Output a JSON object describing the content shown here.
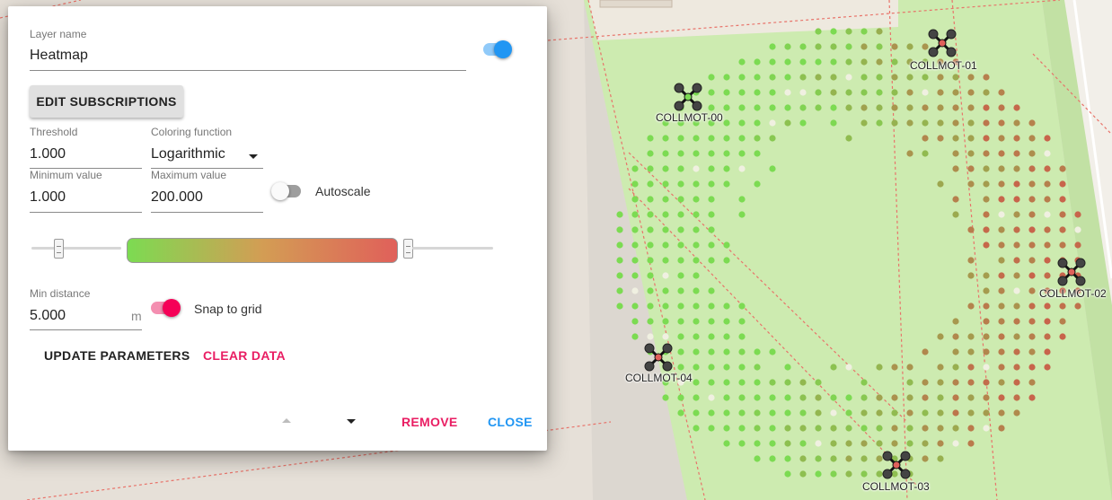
{
  "drones": [
    {
      "label": "COLLMOT-00"
    },
    {
      "label": "COLLMOT-01"
    },
    {
      "label": "COLLMOT-02"
    },
    {
      "label": "COLLMOT-03"
    },
    {
      "label": "COLLMOT-04"
    }
  ],
  "colors": {
    "accent_blue": "#2196f3",
    "accent_pink": "#f50057",
    "heat_low": "#7cdb52",
    "heat_high": "#e0605a",
    "map_park": "#cdebb0"
  },
  "dialog": {
    "layer_name": {
      "label": "Layer name",
      "value": "Heatmap",
      "enabled": true
    },
    "edit_subscriptions_label": "EDIT SUBSCRIPTIONS",
    "threshold": {
      "label": "Threshold",
      "value": "1.000"
    },
    "coloring_function": {
      "label": "Coloring function",
      "value": "Logarithmic"
    },
    "minimum_value": {
      "label": "Minimum value",
      "value": "1.000"
    },
    "maximum_value": {
      "label": "Maximum value",
      "value": "200.000"
    },
    "autoscale": {
      "label": "Autoscale",
      "enabled": false
    },
    "min_distance": {
      "label": "Min distance",
      "value": "5.000",
      "unit": "m"
    },
    "snap_to_grid": {
      "label": "Snap to grid",
      "enabled": true
    },
    "update_parameters_label": "UPDATE PARAMETERS",
    "clear_data_label": "CLEAR DATA",
    "remove_label": "REMOVE",
    "close_label": "CLOSE"
  }
}
